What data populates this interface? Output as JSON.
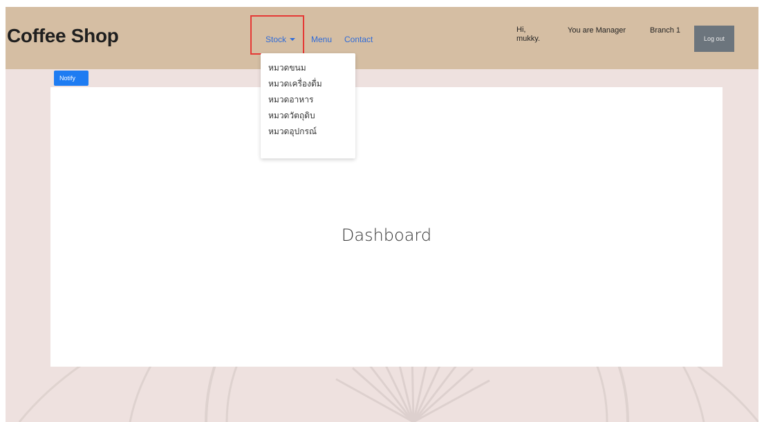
{
  "header": {
    "brand": "Coffee Shop",
    "nav": {
      "stock_label": "Stock",
      "menu_label": "Menu",
      "contact_label": "Contact"
    },
    "greeting_line1": "Hi,",
    "greeting_line2": "mukky.",
    "role_text": "You are Manager",
    "branch_text": "Branch 1",
    "logout_label": "Log out"
  },
  "stock_dropdown": {
    "items": [
      "หมวดขนม",
      "หมวดเครื่องดื่ม",
      "หมวดอาหาร",
      "หมวดวัตถุดิบ",
      "หมวดอุปกรณ์"
    ]
  },
  "notify_label": "Notify",
  "main": {
    "title": "Dashboard"
  },
  "colors": {
    "navbar_bg": "#d5bea3",
    "page_bg": "#eee1df",
    "link": "#2f6bd8",
    "notify_bg": "#1e7cf2",
    "logout_bg": "#6c757d",
    "highlight": "#e53935"
  }
}
